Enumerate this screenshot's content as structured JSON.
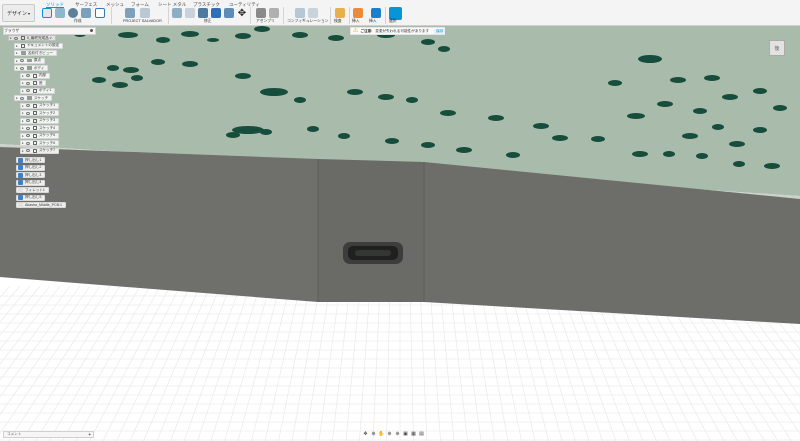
{
  "toolbar": {
    "workspace_label": "デザイン",
    "tabs": [
      "ソリッド",
      "サーフェス",
      "メッシュ",
      "フォーム",
      "シート メタル",
      "プラスチック",
      "ユーティリティ"
    ],
    "groups": {
      "create": "作成",
      "addin": "PROJECT SALVADOR",
      "modify": "修正",
      "assemble": "アセンブリ",
      "configure": "コンフィギュレーション",
      "inspect": "検査",
      "insert": "挿入",
      "select": "選択"
    }
  },
  "browser": {
    "title": "ブラウザ",
    "root": "0_最終完成品 v",
    "items": [
      {
        "label": "ドキュメントの設定",
        "kind": "settings"
      },
      {
        "label": "名前付きビュー",
        "kind": "folder"
      },
      {
        "label": "原点",
        "kind": "folder"
      },
      {
        "label": "ボディ",
        "kind": "folder"
      },
      {
        "label": "内部",
        "kind": "body"
      },
      {
        "label": "底",
        "kind": "body"
      },
      {
        "label": "ボディ1",
        "kind": "body"
      },
      {
        "label": "スケッチ",
        "kind": "folder"
      },
      {
        "label": "スケッチ1",
        "kind": "sketch"
      },
      {
        "label": "スケッチ2",
        "kind": "sketch"
      },
      {
        "label": "スケッチ3",
        "kind": "sketch"
      },
      {
        "label": "スケッチ4",
        "kind": "sketch"
      },
      {
        "label": "スケッチ5",
        "kind": "sketch"
      },
      {
        "label": "スケッチ6",
        "kind": "sketch"
      },
      {
        "label": "スケッチ7",
        "kind": "sketch"
      }
    ],
    "timeline": [
      "押し出し1",
      "押し出し2",
      "押し出し3",
      "押し出し4",
      "フィレット1",
      "押し出し5",
      "Akasha_Middle_PCB:1"
    ]
  },
  "warning": {
    "title": "ご注意:",
    "message": "変更が失われる可能性があります",
    "link": "保存"
  },
  "viewcube": {
    "label": "後"
  },
  "comments": {
    "label": "コメント",
    "plus": "+"
  },
  "navbar": {
    "icons": [
      "✥",
      "⊕",
      "✋",
      "⊕",
      "⊕",
      "▣",
      "▦",
      "▤"
    ]
  },
  "colors": {
    "accent": "#0696d7",
    "plate_top": "#a9bcab",
    "wall": "#6c6d6a",
    "hole": "#174d3c"
  }
}
